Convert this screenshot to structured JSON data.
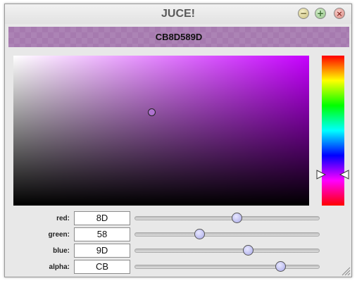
{
  "window": {
    "title": "JUCE!",
    "buttons": {
      "minimise": "−",
      "maximise": "+",
      "close": "×"
    }
  },
  "preview": {
    "hex": "CB8D589D",
    "color": "#a67aaf"
  },
  "picker": {
    "hue_color": "#c600ff"
  },
  "channels": [
    {
      "label": "red:",
      "value": "8D",
      "level": 0.553
    },
    {
      "label": "green:",
      "value": "58",
      "level": 0.345
    },
    {
      "label": "blue:",
      "value": "9D",
      "level": 0.616
    },
    {
      "label": "alpha:",
      "value": "CB",
      "level": 0.796
    }
  ]
}
